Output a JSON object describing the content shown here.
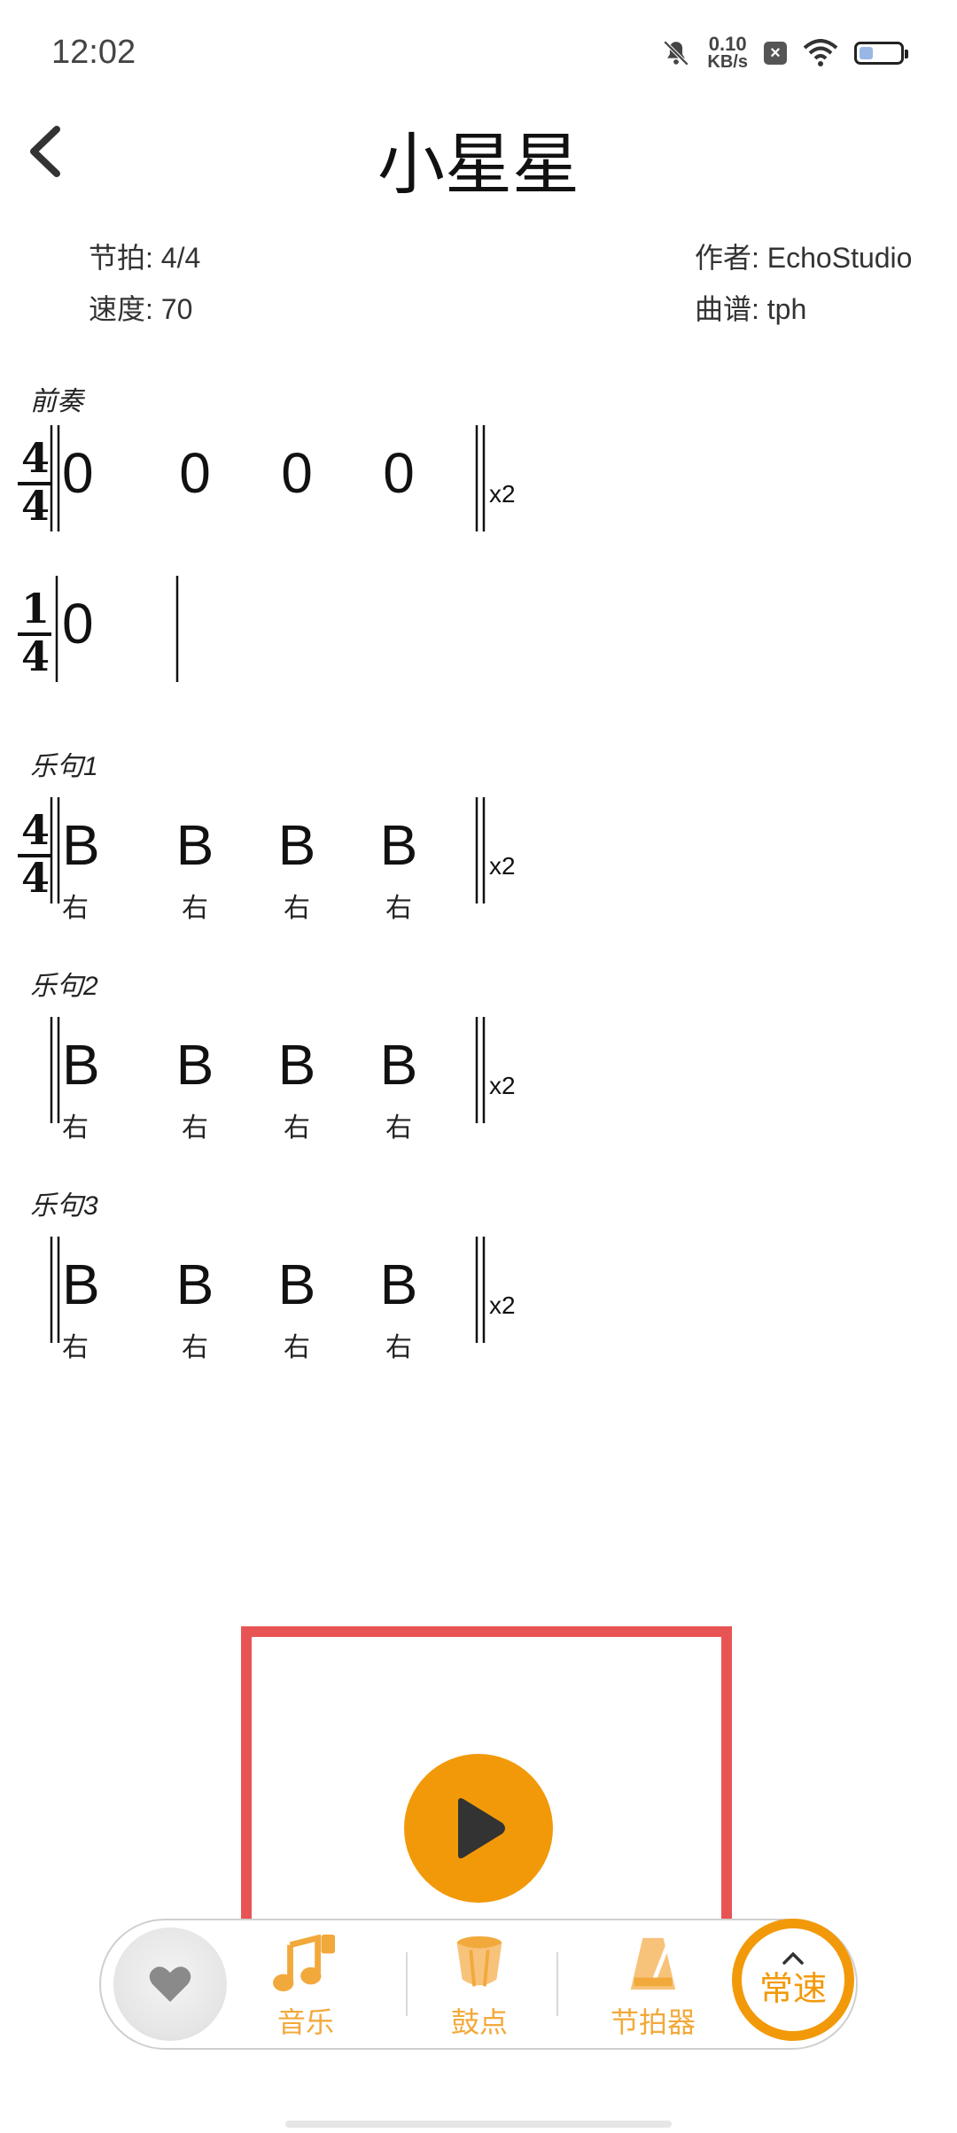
{
  "status_bar": {
    "time": "12:02",
    "net_speed_value": "0.10",
    "net_speed_unit": "KB/s",
    "battery_level": 0.35
  },
  "header": {
    "title": "小星星"
  },
  "meta": {
    "beat": "节拍: 4/4",
    "tempo": "速度: 70",
    "author": "作者: EchoStudio",
    "score_by": "曲谱: tph"
  },
  "score": {
    "sections": [
      {
        "label": "前奏",
        "rows": [
          {
            "time_sig": [
              "4",
              "4"
            ],
            "notes": [
              "0",
              "0",
              "0",
              "0"
            ],
            "hands": [],
            "repeat": "x2"
          },
          {
            "time_sig": [
              "1",
              "4"
            ],
            "notes": [
              "0"
            ],
            "hands": [],
            "repeat": ""
          }
        ]
      },
      {
        "label": "乐句1",
        "rows": [
          {
            "time_sig": [
              "4",
              "4"
            ],
            "notes": [
              "B",
              "B",
              "B",
              "B"
            ],
            "hands": [
              "右",
              "右",
              "右",
              "右"
            ],
            "repeat": "x2"
          }
        ]
      },
      {
        "label": "乐句2",
        "rows": [
          {
            "time_sig": [],
            "notes": [
              "B",
              "B",
              "B",
              "B"
            ],
            "hands": [
              "右",
              "右",
              "右",
              "右"
            ],
            "repeat": "x2"
          }
        ]
      },
      {
        "label": "乐句3",
        "rows": [
          {
            "time_sig": [],
            "notes": [
              "B",
              "B",
              "B",
              "B"
            ],
            "hands": [
              "右",
              "右",
              "右",
              "右"
            ],
            "repeat": "x2"
          }
        ]
      }
    ]
  },
  "toolbar": {
    "music_label": "音乐",
    "drum_label": "鼓点",
    "metronome_label": "节拍器",
    "speed_label": "常速"
  },
  "colors": {
    "accent": "#f2990a",
    "accent_light": "#f2a93b",
    "highlight": "#e85454"
  }
}
